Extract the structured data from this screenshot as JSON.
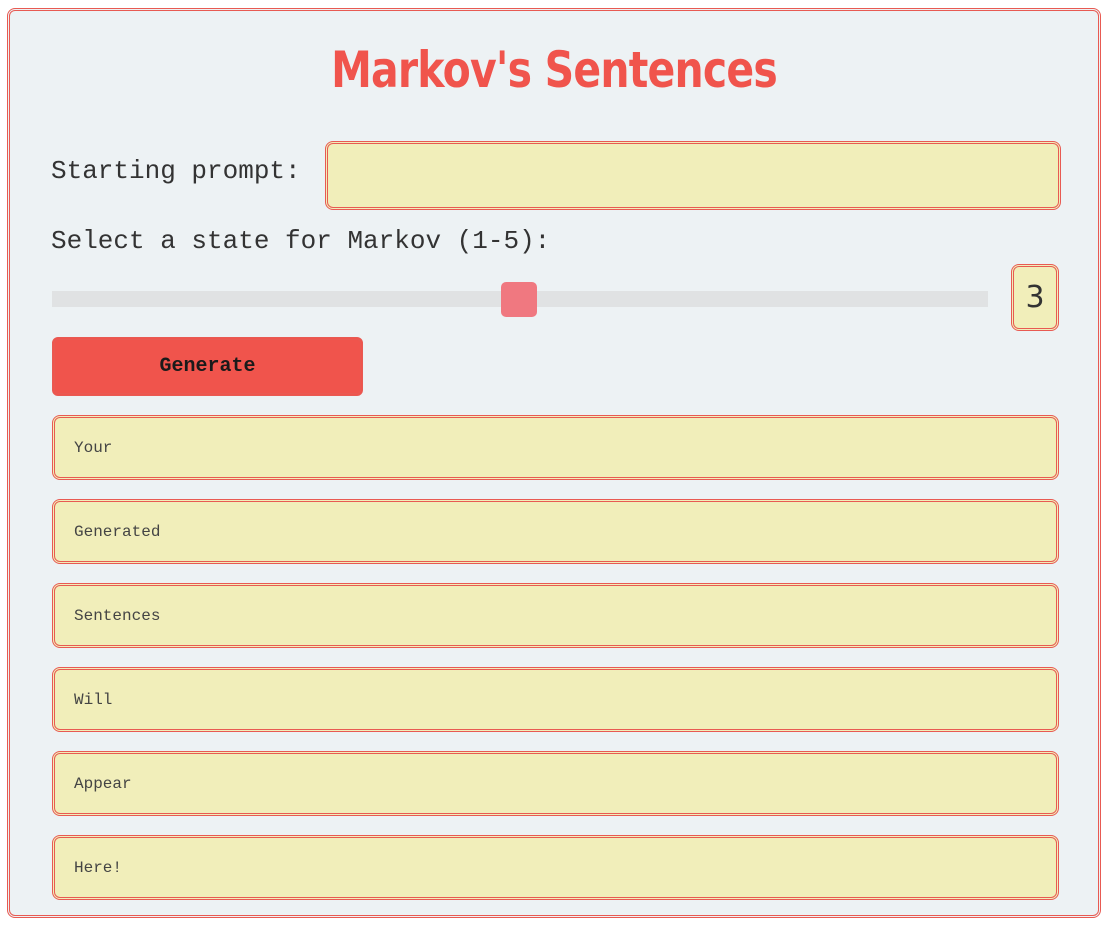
{
  "title": "Markov's Sentences",
  "prompt": {
    "label": "Starting prompt:",
    "value": "",
    "placeholder": ""
  },
  "state": {
    "label": "Select a state for Markov (1-5):",
    "min": 1,
    "max": 5,
    "value": "3"
  },
  "generate_label": "Generate",
  "outputs": [
    "Your",
    "Generated",
    "Sentences",
    "Will",
    "Appear",
    "Here!"
  ],
  "colors": {
    "accent": "#f0544c",
    "field_bg": "#f1eeba",
    "panel_bg": "#edf2f4",
    "slider_thumb": "#f07880"
  },
  "icons": {
    "slider": "slider-thumb"
  }
}
